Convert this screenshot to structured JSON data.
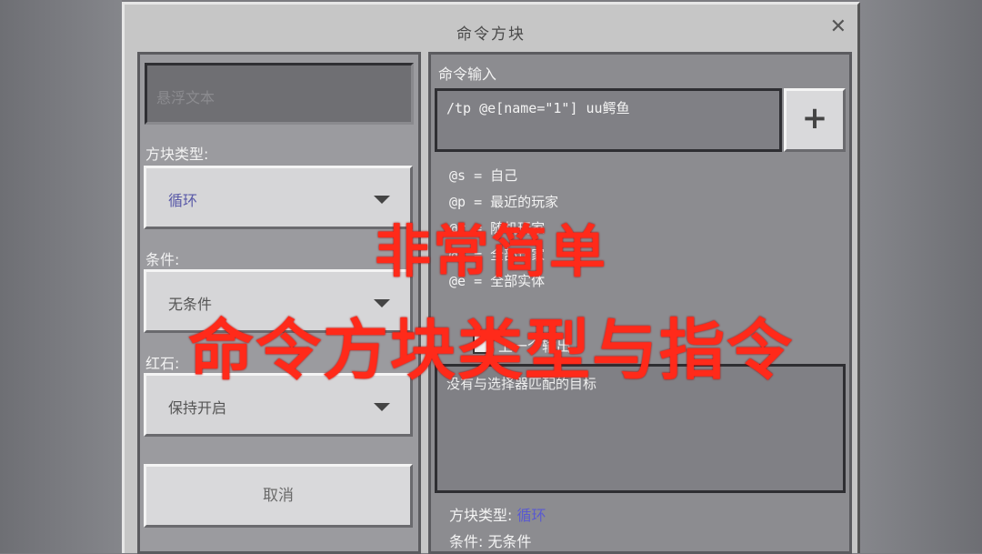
{
  "window": {
    "title": "命令方块"
  },
  "left_panel": {
    "hover_text_placeholder": "悬浮文本",
    "block_type_label": "方块类型:",
    "block_type_value": "循环",
    "condition_label": "条件:",
    "condition_value": "无条件",
    "redstone_label": "红石:",
    "redstone_value": "保持开启",
    "cancel_label": "取消"
  },
  "right_panel": {
    "command_input_label": "命令输入",
    "command_value": "/tp @e[name=\"1\"] uu鳄鱼",
    "add_label": "+",
    "selectors": [
      "@s = 自己",
      "@p = 最近的玩家",
      "@r = 随机玩家",
      "@a = 全部玩家",
      "@e = 全部实体"
    ],
    "previous_output_label": "上一个输出",
    "output_text": "没有与选择器匹配的目标",
    "status_block_type_label": "方块类型:",
    "status_block_type_value": "循环",
    "status_condition": "条件: 无条件"
  },
  "overlay": {
    "line1": "非常简单",
    "line2": "命令方块类型与指令"
  },
  "colors": {
    "overlay_red": "#ff2a1a",
    "type_blue": "#5a5aa8"
  }
}
